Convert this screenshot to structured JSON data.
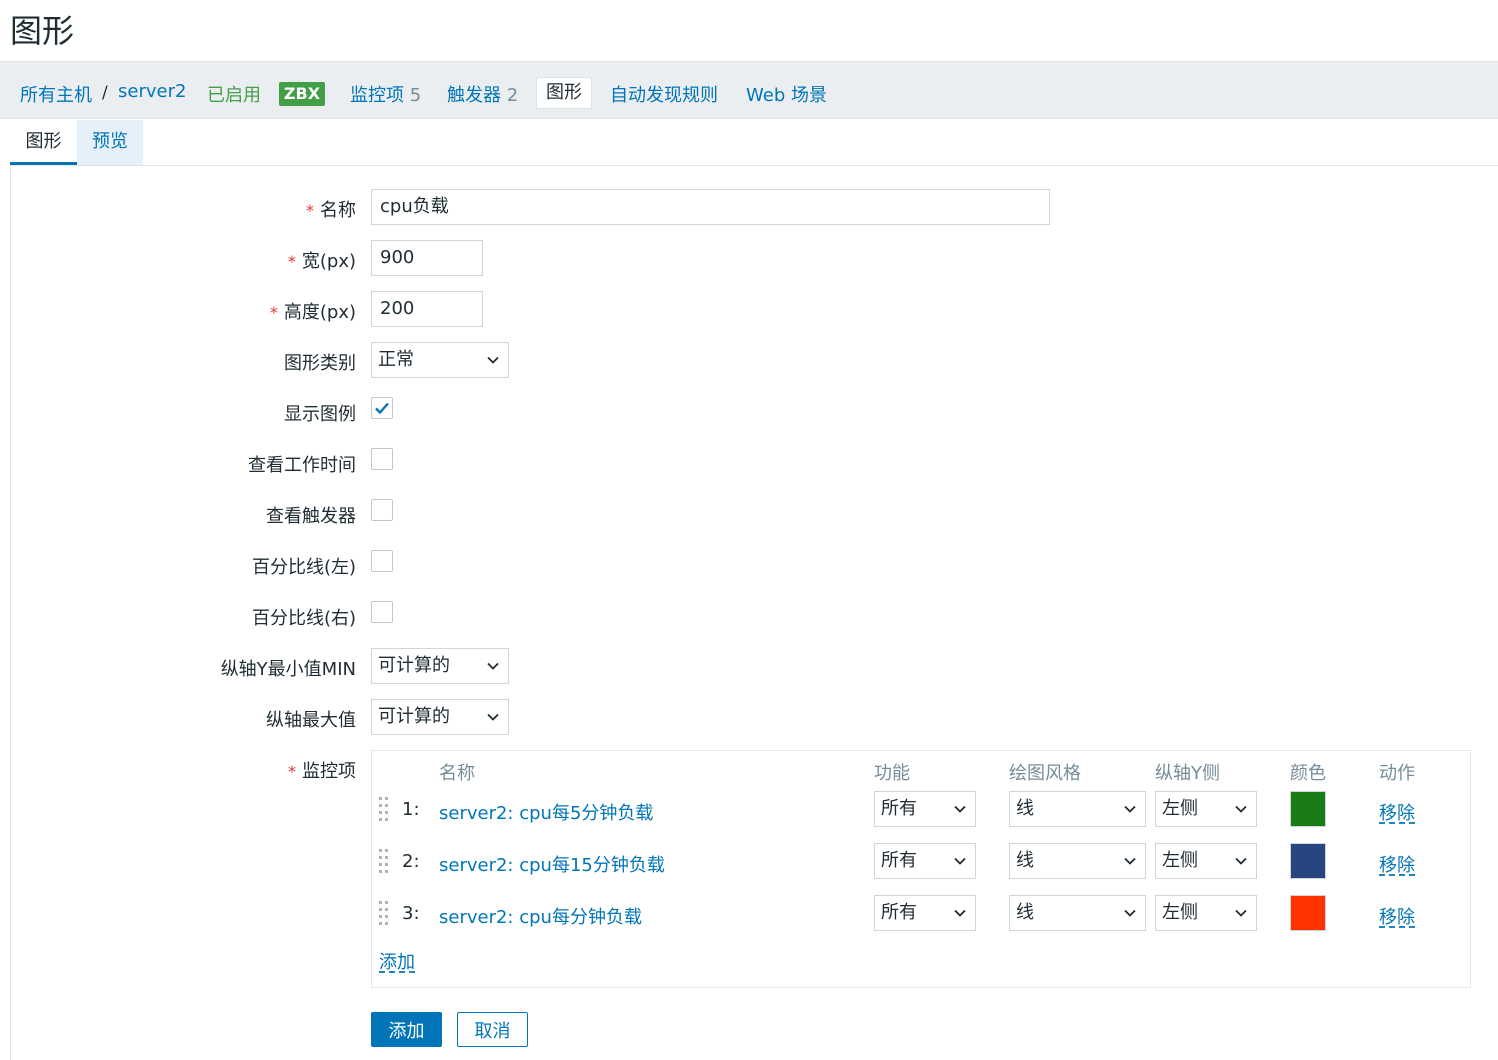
{
  "page": {
    "title": "图形"
  },
  "nav": {
    "all_hosts": "所有主机",
    "separator": "/",
    "host": "server2",
    "status": "已启用",
    "zbx_badge": "ZBX",
    "items_label": "监控项",
    "items_count": "5",
    "triggers_label": "触发器",
    "triggers_count": "2",
    "graphs_label": "图形",
    "discovery_label": "自动发现规则",
    "web_label": "Web 场景"
  },
  "tabs": [
    {
      "label": "图形",
      "active": true
    },
    {
      "label": "预览",
      "active": false
    }
  ],
  "form": {
    "name_label": "名称",
    "name_value": "cpu负载",
    "width_label": "宽(px)",
    "width_value": "900",
    "height_label": "高度(px)",
    "height_value": "200",
    "graph_type_label": "图形类别",
    "graph_type_value": "正常",
    "show_legend_label": "显示图例",
    "show_legend_checked": true,
    "show_work_period_label": "查看工作时间",
    "show_work_period_checked": false,
    "show_triggers_label": "查看触发器",
    "show_triggers_checked": false,
    "percentile_left_label": "百分比线(左)",
    "percentile_left_checked": false,
    "percentile_right_label": "百分比线(右)",
    "percentile_right_checked": false,
    "ymin_label": "纵轴Y最小值MIN",
    "ymin_value": "可计算的",
    "ymax_label": "纵轴最大值",
    "ymax_value": "可计算的",
    "items_label": "监控项",
    "required_mark": "*"
  },
  "items_table": {
    "headers": {
      "name": "名称",
      "function": "功能",
      "draw_style": "绘图风格",
      "y_axis_side": "纵轴Y侧",
      "color": "颜色",
      "action": "动作"
    },
    "rows": [
      {
        "num": "1:",
        "name": "server2: cpu每5分钟负载",
        "function": "所有",
        "draw_style": "线",
        "y_axis_side": "左侧",
        "color": "#1a7c14",
        "action": "移除"
      },
      {
        "num": "2:",
        "name": "server2: cpu每15分钟负载",
        "function": "所有",
        "draw_style": "线",
        "y_axis_side": "左侧",
        "color": "#27457f",
        "action": "移除"
      },
      {
        "num": "3:",
        "name": "server2: cpu每分钟负载",
        "function": "所有",
        "draw_style": "线",
        "y_axis_side": "左侧",
        "color": "#ff3300",
        "action": "移除"
      }
    ],
    "add_label": "添加"
  },
  "buttons": {
    "add": "添加",
    "cancel": "取消"
  },
  "colors": {
    "link": "#0275b8",
    "enabled": "#429e47",
    "required": "#e33734"
  }
}
